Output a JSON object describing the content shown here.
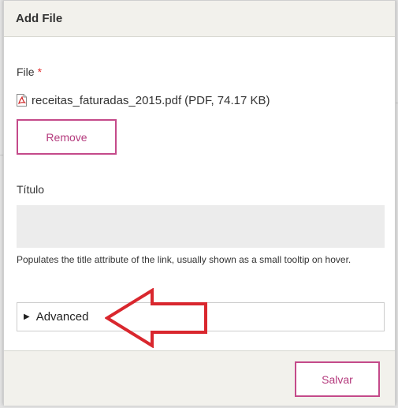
{
  "dialog": {
    "title": "Add File"
  },
  "file_field": {
    "label": "File",
    "required_mark": "*",
    "file_name": "receitas_faturadas_2015.pdf",
    "file_meta": "(PDF, 74.17 KB)",
    "remove_label": "Remove"
  },
  "title_field": {
    "label": "Título",
    "value": "",
    "help": "Populates the title attribute of the link, usually shown as a small tooltip on hover."
  },
  "advanced": {
    "caret": "▶",
    "label": "Advanced"
  },
  "footer": {
    "save_label": "Salvar"
  },
  "colors": {
    "accent": "#c44a8a",
    "annotation_arrow": "#d9272e",
    "header_bg": "#f2f1ec"
  },
  "icons": {
    "file": "pdf-file-icon",
    "annotation": "left-arrow-annotation"
  }
}
